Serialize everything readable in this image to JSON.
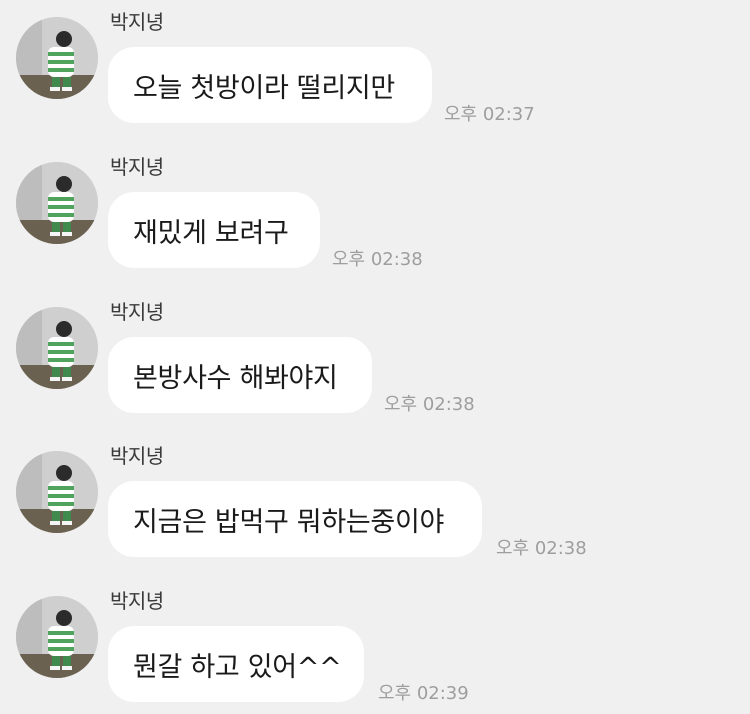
{
  "sender_name": "박지녕",
  "messages": [
    {
      "text": "오늘 첫방이라 떨리지만",
      "time": "오후 02:37"
    },
    {
      "text": "재밌게 보려구",
      "time": "오후 02:38"
    },
    {
      "text": "본방사수 해봐야지",
      "time": "오후 02:38"
    },
    {
      "text": "지금은 밥먹구 뭐하는중이야",
      "time": "오후 02:38"
    },
    {
      "text": "뭔갈 하고 있어^^",
      "time": "오후 02:39"
    }
  ]
}
